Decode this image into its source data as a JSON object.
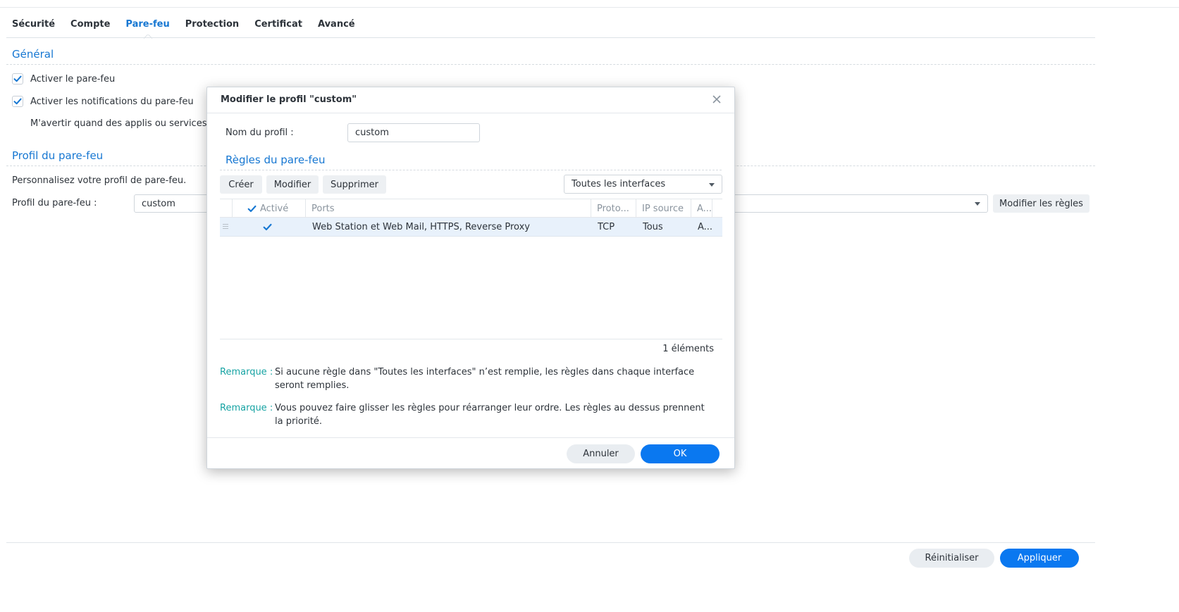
{
  "tabs": [
    "Sécurité",
    "Compte",
    "Pare-feu",
    "Protection",
    "Certificat",
    "Avancé"
  ],
  "general": {
    "title": "Général",
    "enable_firewall": "Activer le pare-feu",
    "enable_notifications": "Activer les notifications du pare-feu",
    "warn_text": "M'avertir quand des applis ou services sc"
  },
  "profile": {
    "title": "Profil du pare-feu",
    "description": "Personnalisez votre profil de pare-feu.",
    "label": "Profil du pare-feu :",
    "value": "custom",
    "edit_rules_button": "Modifier les règles"
  },
  "footer": {
    "reset_button": "Réinitialiser",
    "apply_button": "Appliquer"
  },
  "dialog": {
    "title": "Modifier le profil \"custom\"",
    "name_label": "Nom du profil :",
    "name_value": "custom",
    "rules_title": "Règles du pare-feu",
    "buttons": {
      "create": "Créer",
      "edit": "Modifier",
      "delete": "Supprimer"
    },
    "interface_select": "Toutes les interfaces",
    "columns": {
      "active": "Activé",
      "ports": "Ports",
      "protocol": "Proto...",
      "source_ip": "IP source",
      "action": "A..."
    },
    "rows": [
      {
        "ports": "Web Station et Web Mail, HTTPS, Reverse Proxy",
        "protocol": "TCP",
        "source_ip": "Tous",
        "action": "A..."
      }
    ],
    "count": "1 éléments",
    "remarks": [
      {
        "label": "Remarque :",
        "text": "Si aucune règle dans \"Toutes les interfaces\" n’est remplie, les règles dans chaque interface seront remplies."
      },
      {
        "label": "Remarque :",
        "text": "Vous pouvez faire glisser les règles pour réarranger leur ordre. Les règles au dessus prennent la priorité."
      }
    ],
    "cancel_button": "Annuler",
    "ok_button": "OK"
  },
  "colors": {
    "accent": "#1677d2",
    "primary_button": "#0a78f0",
    "remark_label": "#16a3a3",
    "selected_row": "#e8f1fb"
  }
}
